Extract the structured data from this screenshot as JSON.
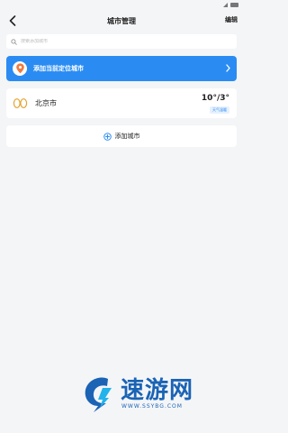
{
  "header": {
    "title": "城市管理",
    "edit_label": "编辑"
  },
  "search": {
    "placeholder": "搜索添加城市"
  },
  "locate": {
    "label": "添加当前定位城市"
  },
  "city": {
    "name": "北京市",
    "temperature": "10°/3°",
    "tag": "天气温暖"
  },
  "add_city": {
    "label": "添加城市"
  },
  "watermark": {
    "title": "速游网",
    "url": "WWW.SSYBG.COM"
  },
  "colors": {
    "accent": "#2a8cf3",
    "background": "#f4f5f7",
    "watermark": "#1a63b5"
  }
}
